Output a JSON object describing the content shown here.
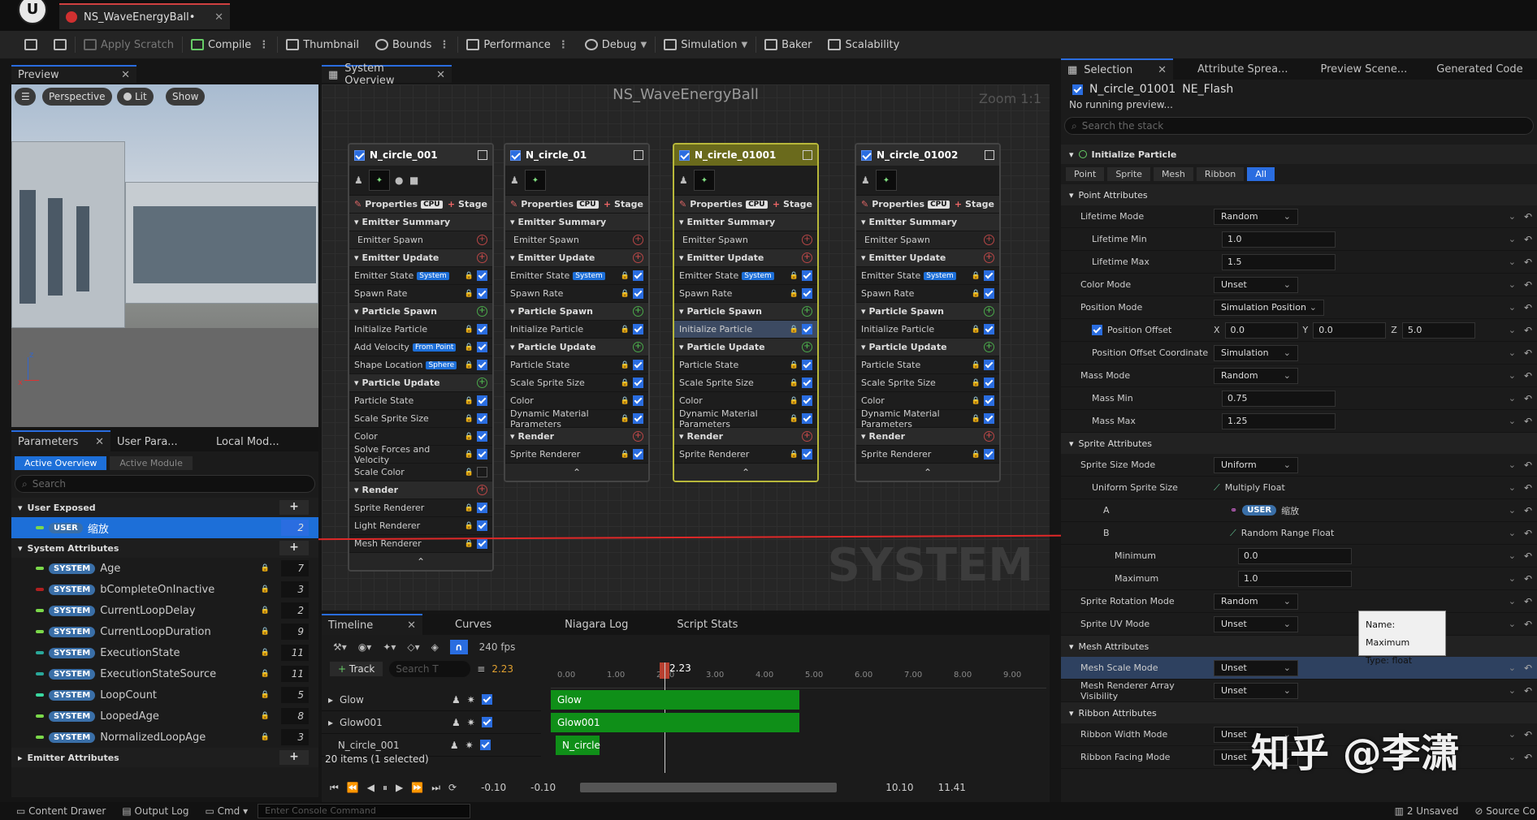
{
  "doc_tab": "NS_WaveEnergyBall•",
  "toolbar": {
    "apply_scratch": "Apply Scratch",
    "compile": "Compile",
    "thumbnail": "Thumbnail",
    "bounds": "Bounds",
    "performance": "Performance",
    "debug": "Debug",
    "simulation": "Simulation",
    "baker": "Baker",
    "scalability": "Scalability"
  },
  "preview": {
    "tab": "Preview",
    "perspective": "Perspective",
    "lit": "Lit",
    "show": "Show"
  },
  "system_overview": {
    "tab": "System Overview",
    "title": "NS_WaveEnergyBall",
    "zoom": "Zoom 1:1",
    "watermark": "SYSTEM"
  },
  "nodes": [
    {
      "name": "N_circle_001",
      "properties": "Properties",
      "stage": "Stage",
      "summary": "Emitter Summary",
      "emitter_spawn": "Emitter Spawn",
      "emitter_update": "Emitter Update",
      "emitter_state": "Emitter State",
      "system_chip": "System",
      "spawn_rate": "Spawn Rate",
      "particle_spawn": "Particle Spawn",
      "init": "Initialize Particle",
      "add_velocity": "Add Velocity",
      "from_point": "From Point",
      "shape_location": "Shape Location",
      "sphere": "Sphere",
      "particle_update": "Particle Update",
      "particle_state": "Particle State",
      "scale_sprite": "Scale Sprite Size",
      "color": "Color",
      "solve": "Solve Forces and Velocity",
      "scale_color": "Scale Color",
      "render": "Render",
      "sprite_renderer": "Sprite Renderer",
      "light_renderer": "Light Renderer",
      "mesh_renderer": "Mesh Renderer"
    },
    {
      "name": "N_circle_01",
      "dyn": "Dynamic Material Parameters"
    },
    {
      "name": "N_circle_01001"
    },
    {
      "name": "N_circle_01002"
    }
  ],
  "params": {
    "tab1": "Parameters",
    "tab2": "User Para...",
    "tab3": "Local Mod...",
    "active_overview": "Active Overview",
    "active_module": "Active Module",
    "search_placeholder": "Search",
    "user_exposed": "User Exposed",
    "user_pill": "USER",
    "user_param": "缩放",
    "user_count": "2",
    "system_attributes": "System Attributes",
    "system_pill": "SYSTEM",
    "emitter_attributes": "Emitter Attributes",
    "sys_items": [
      {
        "name": "Age",
        "count": "7",
        "color": "#7bd84a"
      },
      {
        "name": "bCompleteOnInactive",
        "count": "3",
        "color": "#b02020"
      },
      {
        "name": "CurrentLoopDelay",
        "count": "2",
        "color": "#7bd84a"
      },
      {
        "name": "CurrentLoopDuration",
        "count": "9",
        "color": "#7bd84a"
      },
      {
        "name": "ExecutionState",
        "count": "11",
        "color": "#2aa89a"
      },
      {
        "name": "ExecutionStateSource",
        "count": "11",
        "color": "#2aa89a"
      },
      {
        "name": "LoopCount",
        "count": "5",
        "color": "#3ad8a0"
      },
      {
        "name": "LoopedAge",
        "count": "8",
        "color": "#7bd84a"
      },
      {
        "name": "NormalizedLoopAge",
        "count": "3",
        "color": "#7bd84a"
      }
    ]
  },
  "timeline": {
    "tab": "Timeline",
    "curves": "Curves",
    "niagara_log": "Niagara Log",
    "script_stats": "Script Stats",
    "fps": "240 fps",
    "track_btn": "Track",
    "search": "Search T",
    "time": "2.23",
    "playhead": "2.23",
    "ticks": [
      "0.00",
      "1.00",
      "2.00",
      "3.00",
      "4.00",
      "5.00",
      "6.00",
      "7.00",
      "8.00",
      "9.00"
    ],
    "tracks": [
      {
        "name": "Glow"
      },
      {
        "name": "Glow001"
      },
      {
        "name": "N_circle_001"
      }
    ],
    "items_count": "20 items (1 selected)",
    "start": "-0.10",
    "start2": "-0.10",
    "end": "10.10",
    "end2": "11.41",
    "bar_glow": "Glow",
    "bar_glow001": "Glow001",
    "bar_ncircle": "N_circle"
  },
  "details": {
    "tab_selection": "Selection",
    "tab_attr": "Attribute Sprea...",
    "tab_preview": "Preview Scene...",
    "tab_code": "Generated Code",
    "emitter": "N_circle_01001",
    "emitter_sub": "NE_Flash",
    "running": "No running preview...",
    "search": "Search the stack",
    "module": "Initialize Particle",
    "filters": [
      "Point",
      "Sprite",
      "Mesh",
      "Ribbon",
      "All"
    ],
    "point_attr": "Point Attributes",
    "lifetime_mode": "Lifetime Mode",
    "random": "Random",
    "lifetime_min": "Lifetime Min",
    "lifetime_min_v": "1.0",
    "lifetime_max": "Lifetime Max",
    "lifetime_max_v": "1.5",
    "color_mode": "Color Mode",
    "unset": "Unset",
    "position_mode": "Position Mode",
    "sim_position": "Simulation Position",
    "position_offset": "Position Offset",
    "x": "X",
    "xv": "0.0",
    "y": "Y",
    "yv": "0.0",
    "z": "Z",
    "zv": "5.0",
    "offset_coord": "Position Offset Coordinate",
    "simulation": "Simulation",
    "mass_mode": "Mass Mode",
    "mass_min": "Mass Min",
    "mass_min_v": "0.75",
    "mass_max": "Mass Max",
    "mass_max_v": "1.25",
    "sprite_attr": "Sprite Attributes",
    "sprite_size_mode": "Sprite Size Mode",
    "uniform": "Uniform",
    "uniform_size": "Uniform Sprite Size",
    "multiply_float": "Multiply Float",
    "a": "A",
    "user_pill": "USER",
    "user_param": "缩放",
    "b": "B",
    "random_range": "Random Range Float",
    "minimum": "Minimum",
    "min_v": "0.0",
    "maximum": "Maximum",
    "max_v": "1.0",
    "rotation_mode": "Sprite Rotation Mode",
    "uv_mode": "Sprite UV Mode",
    "tooltip_name": "Name: Maximum",
    "tooltip_type": "Type: float",
    "mesh_attr": "Mesh Attributes",
    "mesh_scale_mode": "Mesh Scale Mode",
    "mesh_array_vis": "Mesh Renderer Array Visibility",
    "ribbon_attr": "Ribbon Attributes",
    "ribbon_width": "Ribbon Width Mode",
    "ribbon_facing": "Ribbon Facing Mode"
  },
  "watermark": "知乎 @李潇",
  "status": {
    "content_drawer": "Content Drawer",
    "output_log": "Output Log",
    "cmd": "Cmd",
    "console_placeholder": "Enter Console Command",
    "unsaved": "2 Unsaved",
    "source": "Source Co"
  },
  "colors": {
    "accent": "#2a6de0",
    "annotation": "#e02828",
    "track_green": "#0f8f18"
  }
}
